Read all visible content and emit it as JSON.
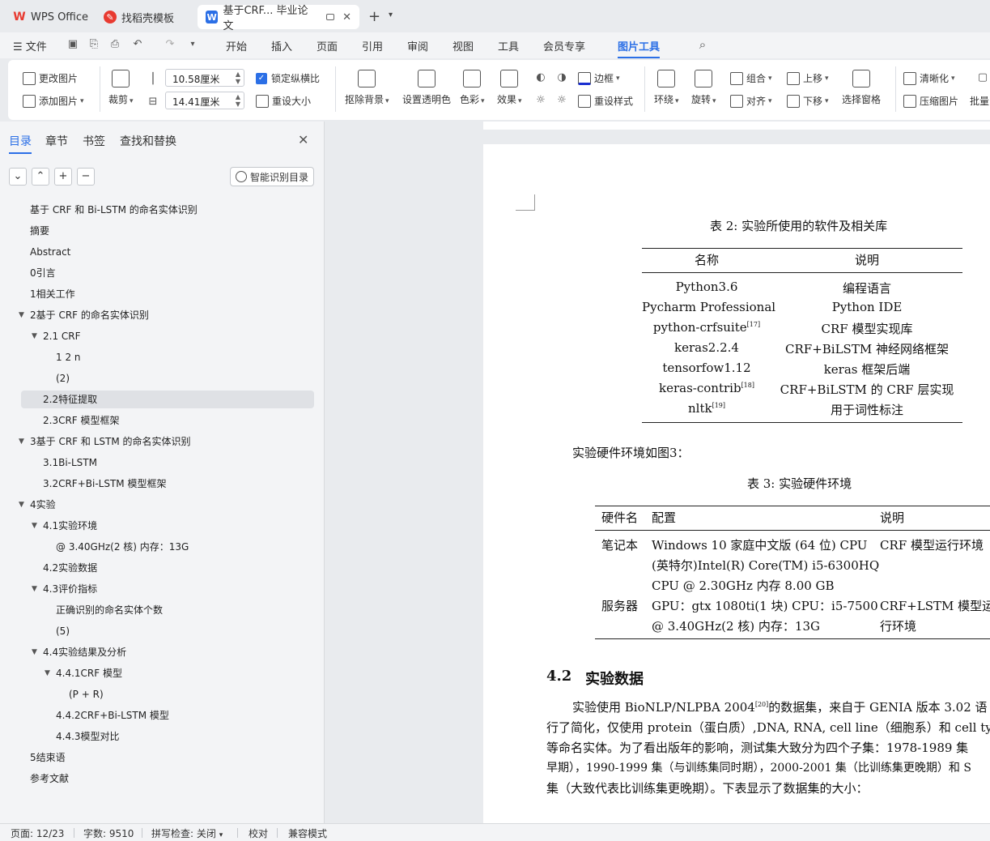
{
  "tabs": [
    {
      "label": "WPS Office",
      "icon": "wps-logo-icon",
      "color": "#e83a30"
    },
    {
      "label": "找稻壳模板",
      "icon": "docer-icon",
      "color": "#e83a30"
    },
    {
      "label": "基于CRF... 毕业论文",
      "icon": "word-doc-icon",
      "color": "#2b6fe6"
    }
  ],
  "menu": {
    "file": "文件",
    "items": [
      "开始",
      "插入",
      "页面",
      "引用",
      "审阅",
      "视图",
      "工具",
      "会员专享",
      "图片工具"
    ],
    "active": "图片工具"
  },
  "ribbon": {
    "change_picture": "更改图片",
    "add_picture": "添加图片",
    "crop": "裁剪",
    "width_value": "10.58厘米",
    "height_value": "14.41厘米",
    "lock_ratio": "锁定纵横比",
    "reset_size": "重设大小",
    "remove_bg": "抠除背景",
    "set_transparent": "设置透明色",
    "color": "色彩",
    "effects": "效果",
    "border": "边框",
    "reset_style": "重设样式",
    "wrap": "环绕",
    "rotate": "旋转",
    "group": "组合",
    "align": "对齐",
    "bring_forward": "上移",
    "send_backward": "下移",
    "selection_pane": "选择窗格",
    "sharpen": "清晰化",
    "compress": "压缩图片",
    "batch": "批量"
  },
  "panel": {
    "tabs": [
      "目录",
      "章节",
      "书签",
      "查找和替换"
    ],
    "smart_toc": "智能识别目录",
    "toc": [
      {
        "label": "基于 CRF 和 Bi-LSTM 的命名实体识别",
        "level": 0,
        "caret": false
      },
      {
        "label": "摘要",
        "level": 0,
        "caret": false
      },
      {
        "label": "Abstract",
        "level": 0,
        "caret": false
      },
      {
        "label": "0引言",
        "level": 0,
        "caret": false
      },
      {
        "label": "1相关工作",
        "level": 0,
        "caret": false
      },
      {
        "label": "2基于 CRF 的命名实体识别",
        "level": 0,
        "caret": true
      },
      {
        "label": "2.1 CRF",
        "level": 1,
        "caret": true
      },
      {
        "label": "1 2 n",
        "level": 2,
        "caret": false
      },
      {
        "label": "(2)",
        "level": 2,
        "caret": false
      },
      {
        "label": "2.2特征提取",
        "level": 1,
        "caret": false,
        "selected": true
      },
      {
        "label": "2.3CRF 模型框架",
        "level": 1,
        "caret": false
      },
      {
        "label": "3基于 CRF 和 LSTM 的命名实体识别",
        "level": 0,
        "caret": true
      },
      {
        "label": "3.1Bi-LSTM",
        "level": 1,
        "caret": false
      },
      {
        "label": "3.2CRF+Bi-LSTM 模型框架",
        "level": 1,
        "caret": false
      },
      {
        "label": "4实验",
        "level": 0,
        "caret": true
      },
      {
        "label": "4.1实验环境",
        "level": 1,
        "caret": true
      },
      {
        "label": "@ 3.40GHz(2 核) 内存：13G",
        "level": 2,
        "caret": false
      },
      {
        "label": "4.2实验数据",
        "level": 1,
        "caret": false
      },
      {
        "label": "4.3评价指标",
        "level": 1,
        "caret": true
      },
      {
        "label": "正确识别的命名实体个数",
        "level": 2,
        "caret": false
      },
      {
        "label": "(5)",
        "level": 2,
        "caret": false
      },
      {
        "label": "4.4实验结果及分析",
        "level": 1,
        "caret": true
      },
      {
        "label": "4.4.1CRF 模型",
        "level": 2,
        "caret": true
      },
      {
        "label": "(P + R)",
        "level": 3,
        "caret": false
      },
      {
        "label": "4.4.2CRF+Bi-LSTM 模型",
        "level": 2,
        "caret": false
      },
      {
        "label": "4.4.3模型对比",
        "level": 2,
        "caret": false
      },
      {
        "label": "5结束语",
        "level": 0,
        "caret": false
      },
      {
        "label": "参考文献",
        "level": 0,
        "caret": false
      }
    ]
  },
  "doc": {
    "table2_caption": "表  2: 实验所使用的软件及相关库",
    "table2_headers": [
      "名称",
      "说明"
    ],
    "table2_rows": [
      {
        "name": "Python3.6",
        "sup": "",
        "desc": "编程语言"
      },
      {
        "name": "Pycharm Professional",
        "sup": "",
        "desc": "Python IDE"
      },
      {
        "name": "python-crfsuite",
        "sup": "[17]",
        "desc": "CRF  模型实现库"
      },
      {
        "name": "keras2.2.4",
        "sup": "",
        "desc": "CRF+BiLSTM 神经网络框架"
      },
      {
        "name": "tensorfow1.12",
        "sup": "",
        "desc": "keras 框架后端"
      },
      {
        "name": "keras-contrib",
        "sup": "[18]",
        "desc": "CRF+BiLSTM 的  CRF 层实现"
      },
      {
        "name": "nltk",
        "sup": "[19]",
        "desc": "用于词性标注"
      }
    ],
    "hw_intro": "实验硬件环境如图3：",
    "table3_caption": "表  3: 实验硬件环境",
    "table3_headers": [
      "硬件名",
      "配置",
      "说明"
    ],
    "table3_rows": [
      {
        "name": "笔记本",
        "config": [
          "Windows 10 家庭中文版  (64 位) CPU",
          "(英特尔)Intel(R) Core(TM) i5-6300HQ",
          "CPU @ 2.30GHz 内存  8.00 GB"
        ],
        "desc": [
          "CRF 模型运行环境"
        ]
      },
      {
        "name": "服务器",
        "config": [
          "GPU：gtx 1080ti(1 块) CPU：i5-7500",
          "@ 3.40GHz(2 核) 内存：13G"
        ],
        "desc": [
          "CRF+LSTM 模型运",
          "行环境"
        ]
      }
    ],
    "section_num": "4.2",
    "section_title": "实验数据",
    "para_line1_a": "实验使用  BioNLP/NLPBA 2004",
    "para_line1_sup": "[20]",
    "para_line1_b": "的数据集，来自于  GENIA 版本 3.02 语",
    "para_lines": [
      "行了简化，仅使用  protein（蛋白质）,DNA, RNA, cell line（细胞系）和 cell type",
      "等命名实体。为了看出版年的影响，测试集大致分为四个子集：1978-1989 集",
      "早期），1990-1999 集（与训练集同时期），2000-2001 集（比训练集更晚期）和  S",
      "集（大致代表比训练集更晚期）。下表显示了数据集的大小："
    ]
  },
  "status": {
    "page": "页面: 12/23",
    "words": "字数: 9510",
    "spell": "拼写检查: 关闭",
    "proof": "校对",
    "compat": "兼容模式"
  }
}
